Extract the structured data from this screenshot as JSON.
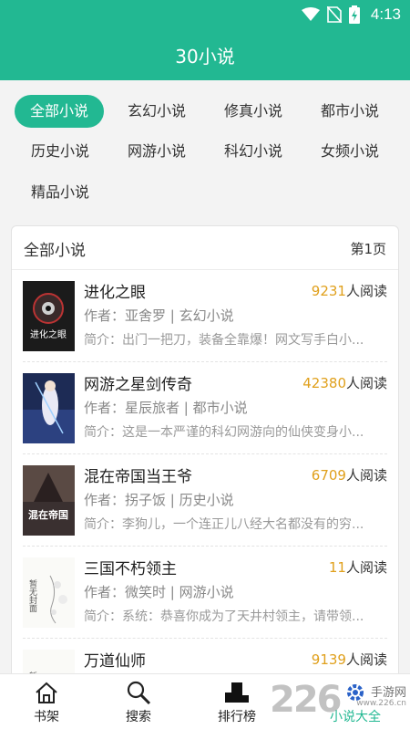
{
  "status": {
    "time": "4:13"
  },
  "app": {
    "title": "30小说"
  },
  "categories": [
    "全部小说",
    "玄幻小说",
    "修真小说",
    "都市小说",
    "历史小说",
    "网游小说",
    "科幻小说",
    "女频小说",
    "精品小说"
  ],
  "list": {
    "title": "全部小说",
    "page": "第1页",
    "books": [
      {
        "title": "进化之眼",
        "readers": "9231",
        "readers_suffix": "人阅读",
        "author": "作者：亚舍罗 | 玄幻小说",
        "summary": "简介：出门一把刀，装备全靠爆！网文写手白小...",
        "cover_text": "进化之眼"
      },
      {
        "title": "网游之星剑传奇",
        "readers": "42380",
        "readers_suffix": "人阅读",
        "author": "作者：星辰旅者 | 都市小说",
        "summary": "简介：这是一本严谨的科幻网游向的仙侠变身小...",
        "cover_text": ""
      },
      {
        "title": "混在帝国当王爷",
        "readers": "6709",
        "readers_suffix": "人阅读",
        "author": "作者：拐子饭 | 历史小说",
        "summary": "简介：李狗儿，一个连正儿八经大名都没有的穷...",
        "cover_text": "混在帝国"
      },
      {
        "title": "三国不朽领主",
        "readers": "11",
        "readers_suffix": "人阅读",
        "author": "作者：微笑时 | 网游小说",
        "summary": "简介：系统：恭喜你成为了天井村领主，请带领...",
        "cover_text": "暂无封面"
      },
      {
        "title": "万道仙师",
        "readers": "9139",
        "readers_suffix": "人阅读",
        "author": "",
        "summary": "",
        "cover_text": "暂无"
      }
    ]
  },
  "tabs": [
    {
      "label": "书架",
      "icon": "home-icon"
    },
    {
      "label": "搜索",
      "icon": "search-icon"
    },
    {
      "label": "排行榜",
      "icon": "podium-icon"
    },
    {
      "label": "小说大全",
      "icon": "gear-icon"
    }
  ],
  "watermark": {
    "number": "226",
    "text": "手游网",
    "url": "www.226.cn"
  },
  "colors": {
    "accent": "#22b892",
    "readers": "#e0a01c"
  }
}
